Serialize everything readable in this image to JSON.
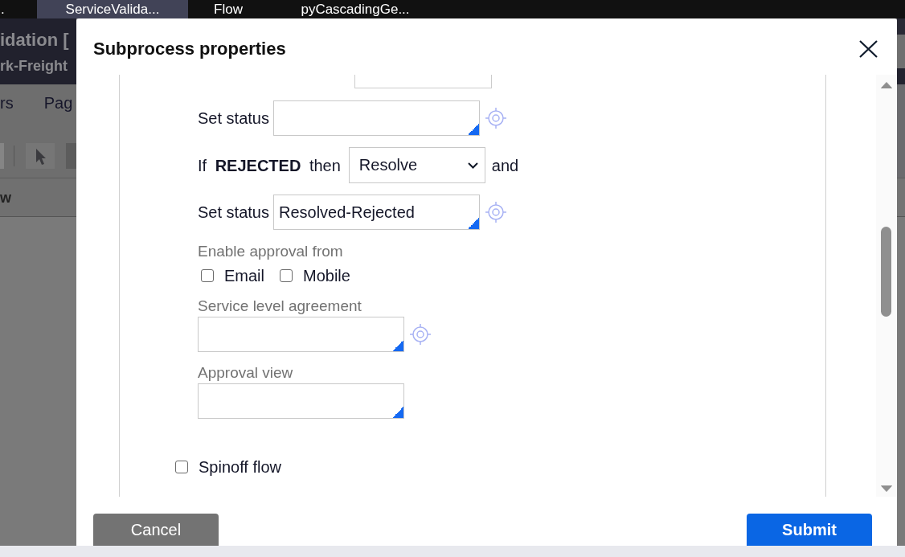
{
  "tabs": [
    {
      "label": ".",
      "selected": false
    },
    {
      "label": "ServiceValida...",
      "selected": true
    },
    {
      "label": "Flow",
      "selected": false
    },
    {
      "label": "pyCascadingGe...",
      "selected": false
    }
  ],
  "background_page": {
    "title": "idation [",
    "subtitle": "rk-Freight",
    "menu": [
      {
        "label": "rs"
      },
      {
        "label": "Pag"
      }
    ],
    "column_header": "w"
  },
  "dialog": {
    "title": "Subprocess properties",
    "fields": [
      {
        "kind": "clipped_select"
      },
      {
        "kind": "inline_text",
        "label": "Set status",
        "picker": true
      },
      {
        "kind": "inline_select",
        "label": "If **REJECTED** then",
        "value": "Resolve",
        "suffix": "and"
      },
      {
        "kind": "inline_text",
        "label": "Set status",
        "value": "Resolved-Rejected",
        "picker": true
      },
      {
        "kind": "checkboxes",
        "label": "Enable approval from",
        "options": [
          {
            "label": "Email",
            "checked": false
          },
          {
            "label": "Mobile",
            "checked": false
          }
        ]
      },
      {
        "kind": "stacked_text",
        "label": "Service level agreement",
        "picker": true
      },
      {
        "kind": "stacked_text",
        "label": "Approval view",
        "picker": false
      }
    ],
    "spinoff": {
      "label": "Spinoff flow",
      "checked": false
    },
    "buttons": [
      {
        "label": "Cancel",
        "kind": "secondary"
      },
      {
        "label": "Submit",
        "kind": "primary"
      }
    ]
  }
}
